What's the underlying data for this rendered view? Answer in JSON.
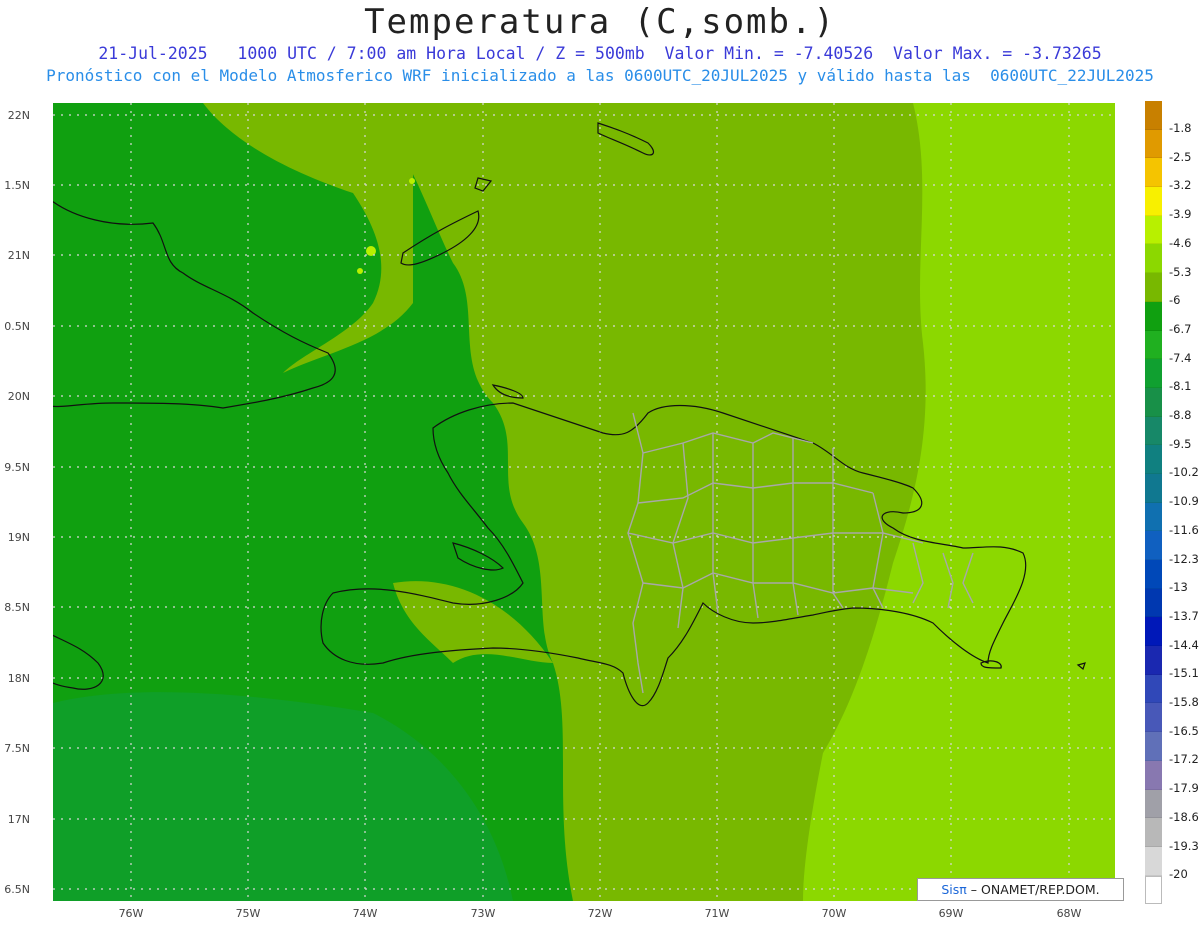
{
  "header": {
    "title": "Temperatura (C,somb.)",
    "line1": "21-Jul-2025   1000 UTC / 7:00 am Hora Local / Z = 500mb  Valor Min. = -7.40526  Valor Max. = -3.73265",
    "line2": "Pronóstico con el Modelo Atmosferico WRF inicializado a las 0600UTC_20JUL2025 y válido hasta las  0600UTC_22JUL2025"
  },
  "axes": {
    "y_ticks": [
      "22N",
      "1.5N",
      "21N",
      "0.5N",
      "20N",
      "9.5N",
      "19N",
      "8.5N",
      "18N",
      "7.5N",
      "17N",
      "6.5N"
    ],
    "x_ticks": [
      "76W",
      "75W",
      "74W",
      "73W",
      "72W",
      "71W",
      "70W",
      "69W",
      "68W"
    ]
  },
  "colorbar": {
    "labels": [
      "-1.8",
      "-2.5",
      "-3.2",
      "-3.9",
      "-4.6",
      "-5.3",
      "-6",
      "-6.7",
      "-7.4",
      "-8.1",
      "-8.8",
      "-9.5",
      "-10.2",
      "-10.9",
      "-11.6",
      "-12.3",
      "-13",
      "-13.7",
      "-14.4",
      "-15.1",
      "-15.8",
      "-16.5",
      "-17.2",
      "-17.9",
      "-18.6",
      "-19.3",
      "-20"
    ],
    "colors": [
      "#c88000",
      "#e09a00",
      "#f5c400",
      "#f8f000",
      "#b8f000",
      "#8cd800",
      "#78b800",
      "#10a010",
      "#20b020",
      "#10a030",
      "#189048",
      "#178868",
      "#108080",
      "#107890",
      "#1070b0",
      "#1060c0",
      "#0048b8",
      "#0038b0",
      "#0018b8",
      "#1a28b0",
      "#3048b8",
      "#4858b8",
      "#6070b8",
      "#8878b0",
      "#a0a0a8",
      "#b8b8b8",
      "#d8d8d8",
      "#ffffff"
    ]
  },
  "credit": {
    "sis": "Sisπ",
    "text": "– ONAMET/REP.DOM."
  },
  "colors": {
    "dark_green": "#10a010",
    "mid_green": "#78b800",
    "light_green": "#8cd800",
    "grid": "#d0d0d0",
    "boundary": "#a8a8a8"
  }
}
